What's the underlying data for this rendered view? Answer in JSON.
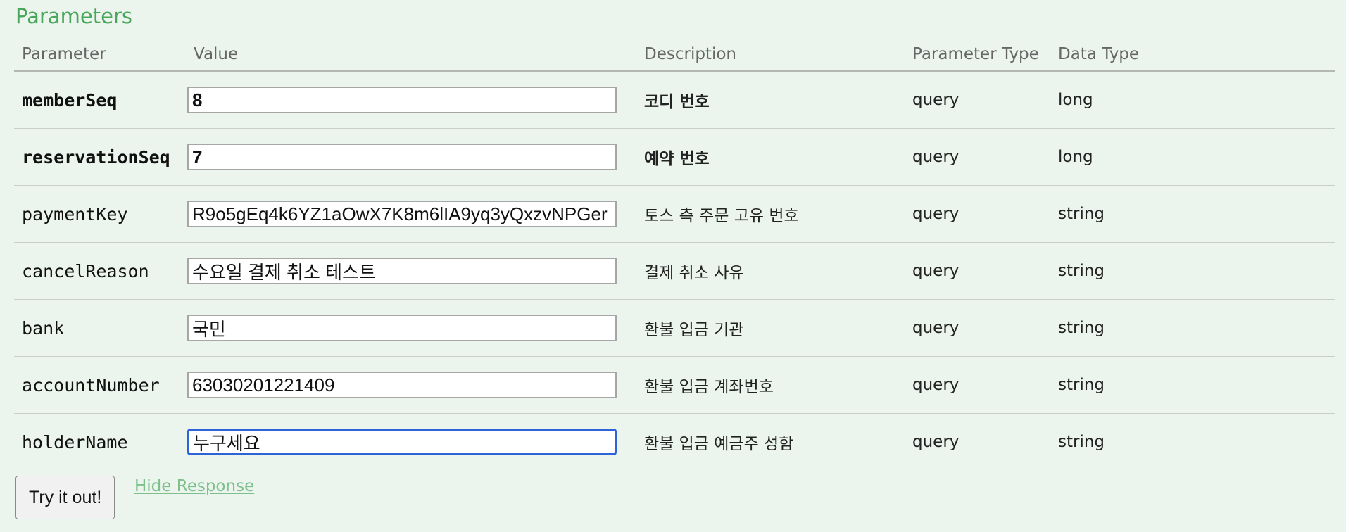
{
  "section_title": "Parameters",
  "columns": {
    "parameter": "Parameter",
    "value": "Value",
    "description": "Description",
    "parameter_type": "Parameter Type",
    "data_type": "Data Type"
  },
  "rows": [
    {
      "name": "memberSeq",
      "value": "8",
      "description": "코디 번호",
      "param_type": "query",
      "data_type": "long",
      "required": true
    },
    {
      "name": "reservationSeq",
      "value": "7",
      "description": "예약 번호",
      "param_type": "query",
      "data_type": "long",
      "required": true
    },
    {
      "name": "paymentKey",
      "value": "R9o5gEq4k6YZ1aOwX7K8m6lIA9yq3yQxzvNPGer",
      "description": "토스 측 주문 고유 번호",
      "param_type": "query",
      "data_type": "string",
      "required": false
    },
    {
      "name": "cancelReason",
      "value": "수요일 결제 취소 테스트",
      "description": "결제 취소 사유",
      "param_type": "query",
      "data_type": "string",
      "required": false
    },
    {
      "name": "bank",
      "value": "국민",
      "description": "환불 입금 기관",
      "param_type": "query",
      "data_type": "string",
      "required": false
    },
    {
      "name": "accountNumber",
      "value": "63030201221409",
      "description": "환불 입금 계좌번호",
      "param_type": "query",
      "data_type": "string",
      "required": false
    },
    {
      "name": "holderName",
      "value": "누구세요",
      "description": "환불 입금 예금주 성함",
      "param_type": "query",
      "data_type": "string",
      "required": false
    }
  ],
  "actions": {
    "try_label": "Try it out!",
    "hide_response_label": "Hide Response"
  }
}
